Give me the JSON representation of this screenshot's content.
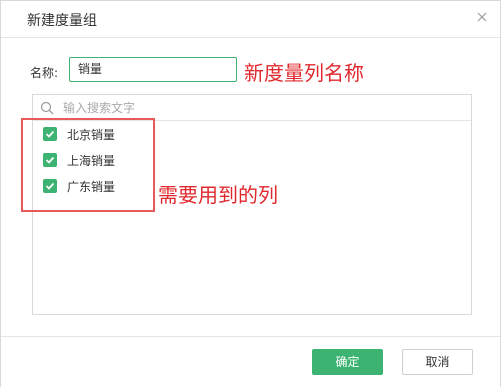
{
  "dialog": {
    "title": "新建度量组",
    "close_icon": "close-icon"
  },
  "form": {
    "name_label": "名称:",
    "name_value": "销量"
  },
  "search": {
    "placeholder": "输入搜索文字",
    "icon": "search-icon"
  },
  "items": [
    {
      "label": "北京销量",
      "checked": true
    },
    {
      "label": "上海销量",
      "checked": true
    },
    {
      "label": "广东销量",
      "checked": true
    }
  ],
  "annotations": {
    "name_note": "新度量列名称",
    "columns_note": "需要用到的列",
    "color": "#e0292e"
  },
  "footer": {
    "ok_label": "确定",
    "cancel_label": "取消"
  },
  "colors": {
    "accent": "#3cb371"
  }
}
